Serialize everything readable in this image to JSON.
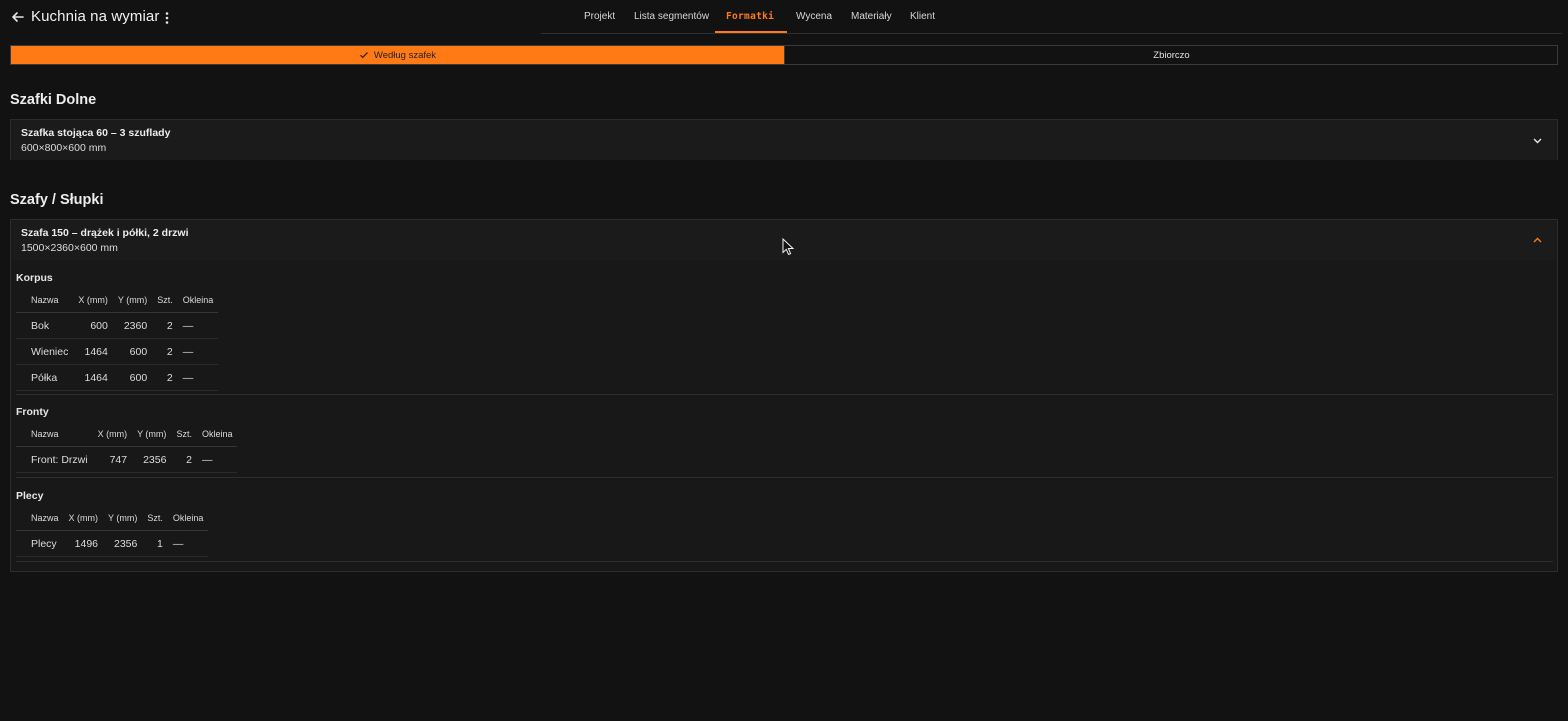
{
  "header": {
    "title": "Kuchnia na wymiar",
    "tabs": [
      "Projekt",
      "Lista segmentów",
      "Formatki",
      "Wycena",
      "Materiały",
      "Klient"
    ],
    "active_tab": "Formatki"
  },
  "toggle": {
    "by_cabinet": "Według szafek",
    "summary": "Zbiorczo",
    "selected": "Według szafek"
  },
  "sections": [
    {
      "title": "Szafki Dolne",
      "cards": [
        {
          "name": "Szafka stojąca 60 – 3 szuflady",
          "dims": "600×800×600 mm",
          "expanded": false
        }
      ]
    },
    {
      "title": "Szafy / Słupki",
      "cards": [
        {
          "name": "Szafa 150 – drążek i półki, 2 drzwi",
          "dims": "1500×2360×600 mm",
          "expanded": true,
          "groups": [
            {
              "title": "Korpus",
              "columns": [
                "Nazwa",
                "X (mm)",
                "Y (mm)",
                "Szt.",
                "Okleina"
              ],
              "rows": [
                [
                  "Bok",
                  "600",
                  "2360",
                  "2",
                  "—"
                ],
                [
                  "Wieniec",
                  "1464",
                  "600",
                  "2",
                  "—"
                ],
                [
                  "Półka",
                  "1464",
                  "600",
                  "2",
                  "—"
                ]
              ]
            },
            {
              "title": "Fronty",
              "columns": [
                "Nazwa",
                "X (mm)",
                "Y (mm)",
                "Szt.",
                "Okleina"
              ],
              "rows": [
                [
                  "Front: Drzwi",
                  "747",
                  "2356",
                  "2",
                  "—"
                ]
              ]
            },
            {
              "title": "Plecy",
              "columns": [
                "Nazwa",
                "X (mm)",
                "Y (mm)",
                "Szt.",
                "Okleina"
              ],
              "rows": [
                [
                  "Plecy",
                  "1496",
                  "2356",
                  "1",
                  "—"
                ]
              ]
            }
          ]
        }
      ]
    }
  ],
  "colors": {
    "accent": "#ff7a14",
    "background": "#121212",
    "card": "#181818"
  },
  "icons": [
    "arrow-left-icon",
    "more-vertical-icon",
    "check-icon",
    "chevron-down-icon",
    "chevron-up-icon",
    "mouse-cursor-icon"
  ]
}
